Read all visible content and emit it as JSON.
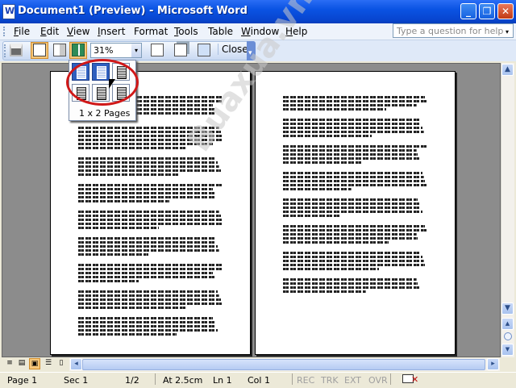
{
  "window": {
    "title": "Document1 (Preview) - Microsoft Word",
    "minimize": "_",
    "maximize": "❐",
    "close": "✕"
  },
  "menu": {
    "items": [
      {
        "first": "F",
        "rest": "ile"
      },
      {
        "first": "E",
        "rest": "dit"
      },
      {
        "first": "V",
        "rest": "iew"
      },
      {
        "first": "I",
        "rest": "nsert"
      },
      {
        "first": "",
        "rest": "Format"
      },
      {
        "first": "T",
        "rest": "ools"
      },
      {
        "first": "",
        "rest": "Table"
      },
      {
        "first": "W",
        "rest": "indow"
      },
      {
        "first": "H",
        "rest": "elp"
      }
    ],
    "help_placeholder": "Type a question for help",
    "help_arrow": "▾"
  },
  "toolbar": {
    "zoom": "31%",
    "zoom_arrow": "▾",
    "close_label": "Close"
  },
  "multipage": {
    "label": "1 x 2 Pages",
    "rows": 2,
    "cols": 3,
    "selected_rows": 1,
    "selected_cols": 2
  },
  "watermark": "Buaxua.vn",
  "status": {
    "page": "Page 1",
    "sec": "Sec 1",
    "count": "1/2",
    "at": "At 2.5cm",
    "ln": "Ln 1",
    "col": "Col 1",
    "rec": "REC",
    "trk": "TRK",
    "ext": "EXT",
    "ovr": "OVR"
  },
  "scroll": {
    "up": "▲",
    "down": "▼",
    "prev": "▲",
    "next": "▼"
  },
  "colors": {
    "titlebar": "#0a53e3",
    "highlight_circle": "#d01818",
    "selected_cell": "#2f5fbf"
  }
}
